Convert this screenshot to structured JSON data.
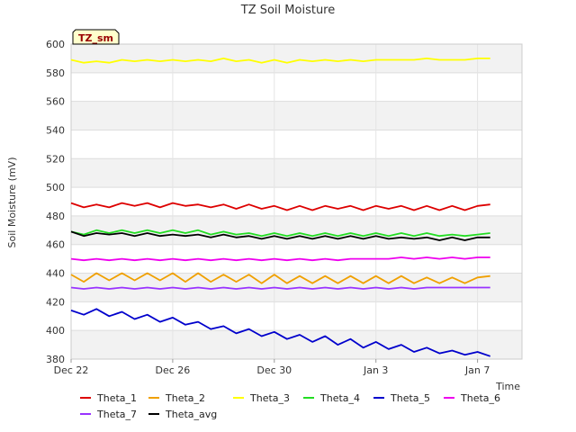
{
  "chart_data": {
    "type": "line",
    "title": "TZ Soil Moisture",
    "badge": "TZ_sm",
    "xlabel": "Time",
    "ylabel": "Soil Moisture (mV)",
    "ylim": [
      380,
      600
    ],
    "yticks": [
      380,
      400,
      420,
      440,
      460,
      480,
      500,
      520,
      540,
      560,
      580,
      600
    ],
    "x_range_days": [
      0,
      16.5
    ],
    "x_ticks": [
      {
        "day": 0,
        "label": "Dec 22"
      },
      {
        "day": 4,
        "label": "Dec 26"
      },
      {
        "day": 8,
        "label": "Dec 30"
      },
      {
        "day": 12,
        "label": "Jan 3"
      },
      {
        "day": 16,
        "label": "Jan 7"
      }
    ],
    "grid": true,
    "legend_position": "bottom",
    "series": [
      {
        "name": "Theta_1",
        "color": "#dd0000",
        "x": [
          0,
          0.5,
          1,
          1.5,
          2,
          2.5,
          3,
          3.5,
          4,
          4.5,
          5,
          5.5,
          6,
          6.5,
          7,
          7.5,
          8,
          8.5,
          9,
          9.5,
          10,
          10.5,
          11,
          11.5,
          12,
          12.5,
          13,
          13.5,
          14,
          14.5,
          15,
          15.5,
          16,
          16.5
        ],
        "y": [
          489,
          486,
          488,
          486,
          489,
          487,
          489,
          486,
          489,
          487,
          488,
          486,
          488,
          485,
          488,
          485,
          487,
          484,
          487,
          484,
          487,
          485,
          487,
          484,
          487,
          485,
          487,
          484,
          487,
          484,
          487,
          484,
          487,
          488
        ]
      },
      {
        "name": "Theta_2",
        "color": "#f0a000",
        "x": [
          0,
          0.5,
          1,
          1.5,
          2,
          2.5,
          3,
          3.5,
          4,
          4.5,
          5,
          5.5,
          6,
          6.5,
          7,
          7.5,
          8,
          8.5,
          9,
          9.5,
          10,
          10.5,
          11,
          11.5,
          12,
          12.5,
          13,
          13.5,
          14,
          14.5,
          15,
          15.5,
          16,
          16.5
        ],
        "y": [
          439,
          434,
          440,
          435,
          440,
          435,
          440,
          435,
          440,
          434,
          440,
          434,
          439,
          434,
          439,
          433,
          439,
          433,
          438,
          433,
          438,
          433,
          438,
          433,
          438,
          433,
          438,
          433,
          437,
          433,
          437,
          433,
          437,
          438
        ]
      },
      {
        "name": "Theta_3",
        "color": "#ffff00",
        "x": [
          0,
          0.5,
          1,
          1.5,
          2,
          2.5,
          3,
          3.5,
          4,
          4.5,
          5,
          5.5,
          6,
          6.5,
          7,
          7.5,
          8,
          8.5,
          9,
          9.5,
          10,
          10.5,
          11,
          11.5,
          12,
          12.5,
          13,
          13.5,
          14,
          14.5,
          15,
          15.5,
          16,
          16.5
        ],
        "y": [
          589,
          587,
          588,
          587,
          589,
          588,
          589,
          588,
          589,
          588,
          589,
          588,
          590,
          588,
          589,
          587,
          589,
          587,
          589,
          588,
          589,
          588,
          589,
          588,
          589,
          589,
          589,
          589,
          590,
          589,
          589,
          589,
          590,
          590
        ]
      },
      {
        "name": "Theta_4",
        "color": "#22dd22",
        "x": [
          0,
          0.5,
          1,
          1.5,
          2,
          2.5,
          3,
          3.5,
          4,
          4.5,
          5,
          5.5,
          6,
          6.5,
          7,
          7.5,
          8,
          8.5,
          9,
          9.5,
          10,
          10.5,
          11,
          11.5,
          12,
          12.5,
          13,
          13.5,
          14,
          14.5,
          15,
          15.5,
          16,
          16.5
        ],
        "y": [
          469,
          467,
          470,
          468,
          470,
          468,
          470,
          468,
          470,
          468,
          470,
          467,
          469,
          467,
          468,
          466,
          468,
          466,
          468,
          466,
          468,
          466,
          468,
          466,
          468,
          466,
          468,
          466,
          468,
          466,
          467,
          466,
          467,
          468
        ]
      },
      {
        "name": "Theta_5",
        "color": "#0000cc",
        "x": [
          0,
          0.5,
          1,
          1.5,
          2,
          2.5,
          3,
          3.5,
          4,
          4.5,
          5,
          5.5,
          6,
          6.5,
          7,
          7.5,
          8,
          8.5,
          9,
          9.5,
          10,
          10.5,
          11,
          11.5,
          12,
          12.5,
          13,
          13.5,
          14,
          14.5,
          15,
          15.5,
          16,
          16.5
        ],
        "y": [
          414,
          411,
          415,
          410,
          413,
          408,
          411,
          406,
          409,
          404,
          406,
          401,
          403,
          398,
          401,
          396,
          399,
          394,
          397,
          392,
          396,
          390,
          394,
          388,
          392,
          387,
          390,
          385,
          388,
          384,
          386,
          383,
          385,
          382
        ]
      },
      {
        "name": "Theta_6",
        "color": "#ee00ee",
        "x": [
          0,
          0.5,
          1,
          1.5,
          2,
          2.5,
          3,
          3.5,
          4,
          4.5,
          5,
          5.5,
          6,
          6.5,
          7,
          7.5,
          8,
          8.5,
          9,
          9.5,
          10,
          10.5,
          11,
          11.5,
          12,
          12.5,
          13,
          13.5,
          14,
          14.5,
          15,
          15.5,
          16,
          16.5
        ],
        "y": [
          450,
          449,
          450,
          449,
          450,
          449,
          450,
          449,
          450,
          449,
          450,
          449,
          450,
          449,
          450,
          449,
          450,
          449,
          450,
          449,
          450,
          449,
          450,
          450,
          450,
          450,
          451,
          450,
          451,
          450,
          451,
          450,
          451,
          451
        ]
      },
      {
        "name": "Theta_7",
        "color": "#9933ff",
        "x": [
          0,
          0.5,
          1,
          1.5,
          2,
          2.5,
          3,
          3.5,
          4,
          4.5,
          5,
          5.5,
          6,
          6.5,
          7,
          7.5,
          8,
          8.5,
          9,
          9.5,
          10,
          10.5,
          11,
          11.5,
          12,
          12.5,
          13,
          13.5,
          14,
          14.5,
          15,
          15.5,
          16,
          16.5
        ],
        "y": [
          430,
          429,
          430,
          429,
          430,
          429,
          430,
          429,
          430,
          429,
          430,
          429,
          430,
          429,
          430,
          429,
          430,
          429,
          430,
          429,
          430,
          429,
          430,
          429,
          430,
          429,
          430,
          429,
          430,
          430,
          430,
          430,
          430,
          430
        ]
      },
      {
        "name": "Theta_avg",
        "color": "#000000",
        "x": [
          0,
          0.5,
          1,
          1.5,
          2,
          2.5,
          3,
          3.5,
          4,
          4.5,
          5,
          5.5,
          6,
          6.5,
          7,
          7.5,
          8,
          8.5,
          9,
          9.5,
          10,
          10.5,
          11,
          11.5,
          12,
          12.5,
          13,
          13.5,
          14,
          14.5,
          15,
          15.5,
          16,
          16.5
        ],
        "y": [
          469,
          466,
          468,
          467,
          468,
          466,
          468,
          466,
          467,
          466,
          467,
          465,
          467,
          465,
          466,
          464,
          466,
          464,
          466,
          464,
          466,
          464,
          466,
          464,
          466,
          464,
          465,
          464,
          465,
          463,
          465,
          463,
          465,
          465
        ]
      }
    ]
  }
}
